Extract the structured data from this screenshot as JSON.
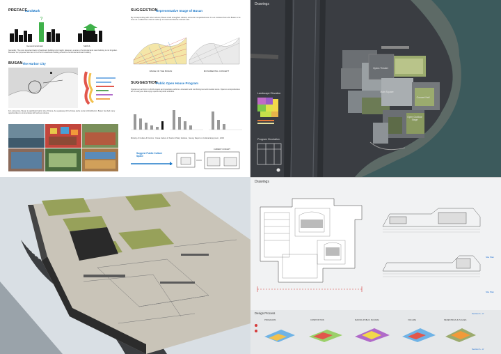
{
  "concept": {
    "preface": "PREFACE",
    "preface_sub": "LandMark",
    "landmark_caption_1": "General landmark",
    "landmark_caption_2": "SEOUL",
    "preface_body": "Generally, The most important factor of landmark building is its height. However, a series of horizontal land mark building is not forgotten. Because our proposed site lies in the Port the landmark building should be horizontal landmark building.",
    "busan": "BUSAN",
    "busan_sub": "The Harbor City",
    "busan_body": "For a long time, Busan is significant harbor city of Korea. As a gateway of the Korea and a center of distribution. Busan has had many opportunities to communicate with various cultures.",
    "suggestion_1": "SUGGESTION",
    "suggestion_1_sub": "Representative Image of Busan",
    "suggestion_1_body": "By Corresponding with other cultures, Busan could strengthen cultural, economic competitiveness. It is an inclusive frame for Busan to be seen as a unified form that is made up of mixed and diverse colored units.",
    "image_caption_1": "IMAGE OF THE BUSAN",
    "image_caption_2": "MONUMENTAL CONCEPT",
    "suggestion_2": "SUGGESTION",
    "suggestion_2_sub": "Public Open House Program",
    "suggestion_2_body": "Opera is an art form in which singers and musicians perform a dramatic work combining text and musical score. Opera is comprehensive art for everyone that enjoys opera and public activities.",
    "source_note": "Ministry of Culture & Tourism : Korea Culture & Tourism Policy Institute , Survey Report on Cultural Enjoyment , 2006",
    "arrow_label": "Suggest Public Culture Space",
    "flow_label": "CURRENT CONCEPT"
  },
  "site": {
    "title": "Drawings",
    "landscape_label": "Landscape Elevation",
    "circulation_label": "Program Circulation",
    "zones": [
      "Opera Theater",
      "Main Square",
      "Concert Hall",
      "Open Outdoor Stage"
    ]
  },
  "plans": {
    "title": "Drawings",
    "site_plan_1": "Site Plan",
    "site_plan_2": "Site Plan",
    "design_process": "Design Process",
    "section_a": "Section A - A'",
    "section_b": "Section A - A'",
    "steps": [
      "PROGRAMS",
      "COMPOSITION",
      "MAKING PUBLIC SQUARE",
      "VOLUME",
      "PEDESTRIAN & PLACES"
    ]
  },
  "colors": {
    "accent_blue": "#1f7ac9",
    "dark_bg": "#3a3d42",
    "water": "#3c5a5c",
    "green_roof": "#9bab6e"
  }
}
